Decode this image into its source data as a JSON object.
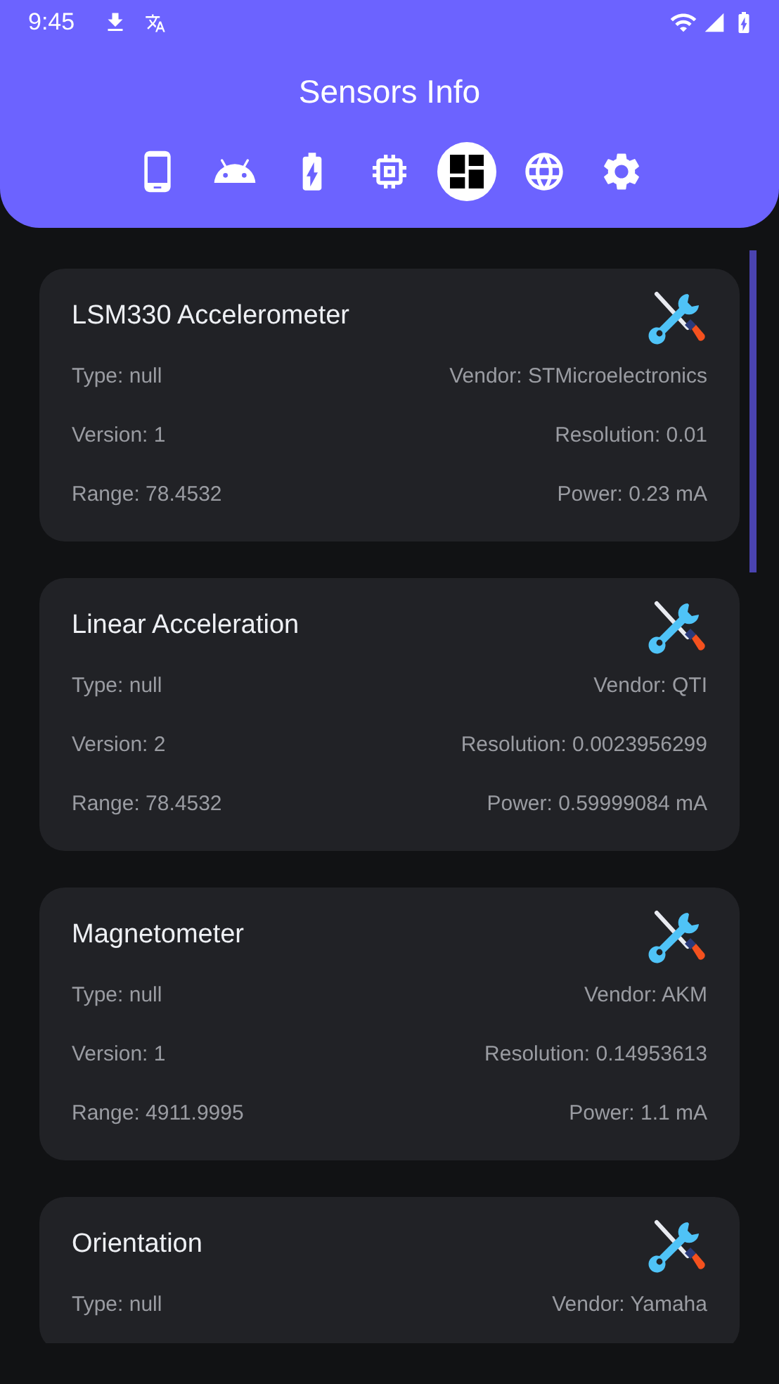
{
  "status_bar": {
    "time": "9:45"
  },
  "app_bar": {
    "title": "Sensors Info"
  },
  "tabs": [
    {
      "kind": "phone",
      "selected": false
    },
    {
      "kind": "android",
      "selected": false
    },
    {
      "kind": "battery",
      "selected": false
    },
    {
      "kind": "cpu",
      "selected": false
    },
    {
      "kind": "sensors",
      "selected": true
    },
    {
      "kind": "network",
      "selected": false
    },
    {
      "kind": "settings",
      "selected": false
    }
  ],
  "sensors": [
    {
      "name": "LSM330 Accelerometer",
      "rows": [
        [
          "Type: null",
          "Vendor: STMicroelectronics"
        ],
        [
          "Version: 1",
          "Resolution: 0.01"
        ],
        [
          "Range: 78.4532",
          "Power: 0.23 mA"
        ]
      ]
    },
    {
      "name": "Linear Acceleration",
      "rows": [
        [
          "Type: null",
          "Vendor: QTI"
        ],
        [
          "Version: 2",
          "Resolution: 0.0023956299"
        ],
        [
          "Range: 78.4532",
          "Power: 0.59999084 mA"
        ]
      ]
    },
    {
      "name": "Magnetometer",
      "rows": [
        [
          "Type: null",
          "Vendor: AKM"
        ],
        [
          "Version: 1",
          "Resolution: 0.14953613"
        ],
        [
          "Range: 4911.9995",
          "Power: 1.1 mA"
        ]
      ]
    },
    {
      "name": "Orientation",
      "rows": [
        [
          "Type: null",
          "Vendor: Yamaha"
        ]
      ]
    }
  ]
}
